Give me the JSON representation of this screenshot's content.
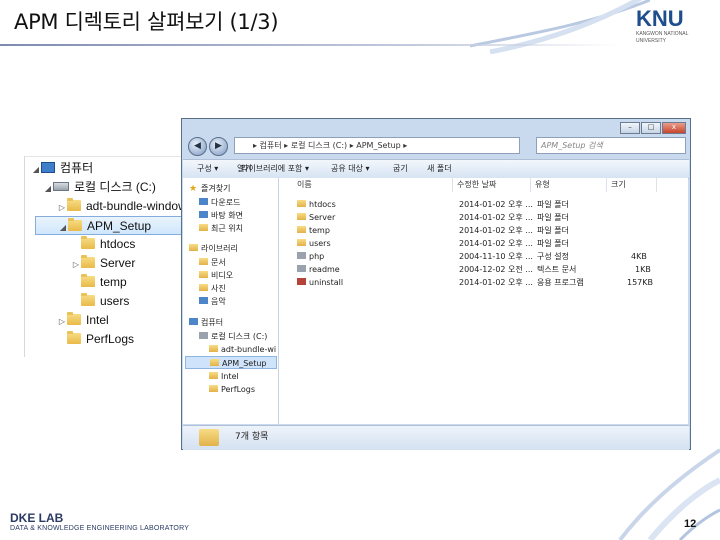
{
  "slide": {
    "title": "APM 디렉토리 살펴보기 (1/3)",
    "logo_mark": "KNU",
    "logo_sub_line1": "KANGWON NATIONAL",
    "logo_sub_line2": "UNIVERSITY",
    "footer_lab": "DKE LAB",
    "footer_lab_sub": "DATA & KNOWLEDGE ENGINEERING LABORATORY",
    "page_number": "12",
    "accent_color": "#1f4e8c"
  },
  "tree_panel": {
    "items": [
      {
        "label": "컴퓨터",
        "icon": "computer-icon",
        "expander": "◢"
      },
      {
        "label": "로컬 디스크 (C:)",
        "icon": "drive-icon",
        "expander": "◢"
      },
      {
        "label": "adt-bundle-windows",
        "icon": "folder-icon",
        "expander": "▷"
      },
      {
        "label": "APM_Setup",
        "icon": "folder-icon",
        "expander": "◢",
        "selected": true
      },
      {
        "label": "htdocs",
        "icon": "folder-icon",
        "expander": ""
      },
      {
        "label": "Server",
        "icon": "folder-icon",
        "expander": "▷"
      },
      {
        "label": "temp",
        "icon": "folder-icon",
        "expander": ""
      },
      {
        "label": "users",
        "icon": "folder-icon",
        "expander": ""
      },
      {
        "label": "Intel",
        "icon": "folder-icon",
        "expander": "▷"
      },
      {
        "label": "PerfLogs",
        "icon": "folder-icon",
        "expander": ""
      }
    ]
  },
  "explorer": {
    "window_buttons": {
      "minimize": "–",
      "maximize": "□",
      "close": "x"
    },
    "back_icon": "◀",
    "forward_icon": "▶",
    "address": "▸ 컴퓨터 ▸ 로컬 디스크 (C:) ▸ APM_Setup ▸",
    "search_placeholder": "APM_Setup 검색",
    "toolbar": {
      "organize": "구성 ▾",
      "open": "열기",
      "include_library": "라이브러리에 포함 ▾",
      "share": "공유 대상 ▾",
      "burn": "굽기",
      "new_folder": "새 폴더"
    },
    "nav_pane": [
      {
        "label": "즐겨찾기",
        "icon": "star-icon"
      },
      {
        "label": "다운로드",
        "icon": "download-icon"
      },
      {
        "label": "바탕 화면",
        "icon": "desktop-icon"
      },
      {
        "label": "최근 위치",
        "icon": "recent-icon"
      },
      {
        "label": "라이브러리",
        "icon": "library-icon"
      },
      {
        "label": "문서",
        "icon": "folder-icon"
      },
      {
        "label": "비디오",
        "icon": "folder-icon"
      },
      {
        "label": "사진",
        "icon": "folder-icon"
      },
      {
        "label": "음악",
        "icon": "music-icon"
      },
      {
        "label": "컴퓨터",
        "icon": "computer-icon"
      },
      {
        "label": "로컬 디스크 (C:)",
        "icon": "drive-icon"
      },
      {
        "label": "adt-bundle-wi",
        "icon": "folder-icon"
      },
      {
        "label": "APM_Setup",
        "icon": "folder-icon",
        "selected": true
      },
      {
        "label": "Intel",
        "icon": "folder-icon"
      },
      {
        "label": "PerfLogs",
        "icon": "folder-icon"
      }
    ],
    "columns": [
      "이름",
      "수정한 날짜",
      "유형",
      "크기"
    ],
    "files": [
      {
        "name": "htdocs",
        "date": "2014-01-02 오후 ...",
        "type": "파일 폴더",
        "size": "",
        "icon": "folder-icon"
      },
      {
        "name": "Server",
        "date": "2014-01-02 오후 ...",
        "type": "파일 폴더",
        "size": "",
        "icon": "folder-icon"
      },
      {
        "name": "temp",
        "date": "2014-01-02 오후 ...",
        "type": "파일 폴더",
        "size": "",
        "icon": "folder-icon"
      },
      {
        "name": "users",
        "date": "2014-01-02 오후 ...",
        "type": "파일 폴더",
        "size": "",
        "icon": "folder-icon"
      },
      {
        "name": "php",
        "date": "2004-11-10 오후 ...",
        "type": "구성 설정",
        "size": "4KB",
        "icon": "settings-file-icon"
      },
      {
        "name": "readme",
        "date": "2004-12-02 오전 ...",
        "type": "텍스트 문서",
        "size": "1KB",
        "icon": "text-file-icon"
      },
      {
        "name": "uninstall",
        "date": "2014-01-02 오후 ...",
        "type": "응용 프로그램",
        "size": "157KB",
        "icon": "app-icon"
      }
    ],
    "status": "7개 항목"
  }
}
